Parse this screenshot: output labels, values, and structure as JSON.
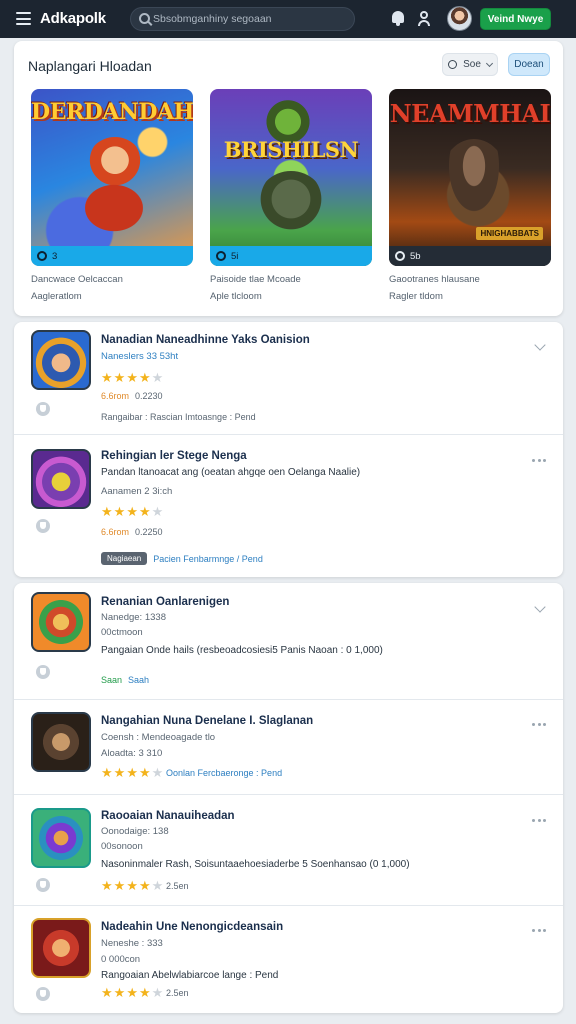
{
  "app": {
    "brand": "Adkapolk"
  },
  "topbar": {
    "search_placeholder": "Sbsobmganhiny segoaan",
    "cta_label": "Veind Nwye"
  },
  "featured": {
    "title": "Naplangari Hloadan",
    "filter_label": "Soe",
    "pill_label": "Doean",
    "cards": [
      {
        "art_title": "DERDANDAH",
        "count": "3",
        "caption1": "Dancwace Oelcaccan",
        "caption2": "Aagleratlom"
      },
      {
        "art_title": "BRISHILSN",
        "count": "5i",
        "caption1": "Paisoide tlae Mcoade",
        "caption2": "Aple tlcloom"
      },
      {
        "art_title": "NEAMMHAI",
        "count": "5b",
        "caption1": "Gaootranes hlausane",
        "caption2": "Ragler tldom",
        "badge": "HNIGHABBATS"
      }
    ]
  },
  "list": [
    {
      "title": "Nanadian Naneadhinne Yaks Oanision",
      "sub": "Naneslers 33 53ht",
      "rating": 4,
      "meta_a": "6.6rom",
      "meta_b": "0.2230",
      "footer": "Rangaibar : Rascian Imtoasnge : Pend",
      "control": "chevron"
    },
    {
      "title": "Rehingian ler Stege Nenga",
      "desc": "Pandan ltanoacat ang (oeatan ahgqe oen Oelanga Naalie)",
      "sub": "Aanamen 2 3i:ch",
      "rating": 4,
      "meta_a": "6.6rom",
      "meta_b": "0.2250",
      "tag": "Nagiaean",
      "footer": "Pacien Fenbarmnge / Pend",
      "control": "kebab"
    },
    {
      "title": "Renanian Oanlarenigen",
      "sub": "Nanedge: 1338",
      "sub2": "00ctmoon",
      "desc": "Pangaian Onde hails (resbeoadcosiesi5 Panis Naoan : 0 1,000)",
      "footer_a": "Saan",
      "footer_b": "Saah",
      "control": "chevron"
    },
    {
      "title": "Nangahian Nuna Denelane I. Slaglanan",
      "sub": "Coensh : Mendeoagade tlo",
      "sub2": "Aloadta: 3 310",
      "rating": 4,
      "footer": "Oonlan Fercbaeronge : Pend",
      "control": "kebab"
    },
    {
      "title": "Raooaian Nanauiheadan",
      "sub": "Oonodaige: 138",
      "sub2": "00sonoon",
      "desc": "Nasoninmaler Rash, Soisuntaaehoesiaderbe 5 Soenhansao (0 1,000)",
      "rating": 4,
      "footer": "2.5en",
      "control": "kebab"
    },
    {
      "title": "Nadeahin Une Nenongicdeansain",
      "sub": "Neneshe : 333",
      "sub2": "0 000con",
      "desc": "Rangoaian Abelwlabiarcoe lange : Pend",
      "rating": 4,
      "footer": "2.5en",
      "control": "kebab"
    }
  ]
}
